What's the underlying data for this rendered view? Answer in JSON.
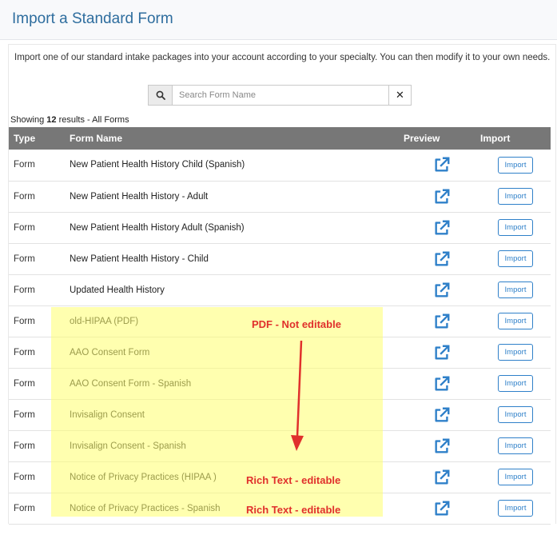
{
  "header": {
    "title": "Import a Standard Form"
  },
  "intro": "Import one of our standard intake packages into your account according to your specialty. You can then modify it to your own needs.",
  "search": {
    "placeholder": "Search Form Name",
    "value": ""
  },
  "results": {
    "prefix": "Showing ",
    "count": "12",
    "suffix": " results - All Forms"
  },
  "table": {
    "headers": {
      "type": "Type",
      "name": "Form Name",
      "preview": "Preview",
      "import": "Import"
    },
    "rows": [
      {
        "type": "Form",
        "name": "New Patient Health History Child (Spanish)",
        "import_label": "Import"
      },
      {
        "type": "Form",
        "name": "New Patient Health History - Adult",
        "import_label": "Import"
      },
      {
        "type": "Form",
        "name": "New Patient Health History Adult (Spanish)",
        "import_label": "Import"
      },
      {
        "type": "Form",
        "name": "New Patient Health History - Child",
        "import_label": "Import"
      },
      {
        "type": "Form",
        "name": "Updated Health History",
        "import_label": "Import"
      },
      {
        "type": "Form",
        "name": "old-HIPAA (PDF)",
        "import_label": "Import"
      },
      {
        "type": "Form",
        "name": "AAO Consent Form",
        "import_label": "Import"
      },
      {
        "type": "Form",
        "name": "AAO Consent Form - Spanish",
        "import_label": "Import"
      },
      {
        "type": "Form",
        "name": "Invisalign Consent",
        "import_label": "Import"
      },
      {
        "type": "Form",
        "name": "Invisalign Consent - Spanish",
        "import_label": "Import"
      },
      {
        "type": "Form",
        "name": "Notice of Privacy Practices (HIPAA )",
        "import_label": "Import"
      },
      {
        "type": "Form",
        "name": "Notice of Privacy Practices - Spanish",
        "import_label": "Import"
      }
    ]
  },
  "annotations": {
    "pdf_note": "PDF - Not editable",
    "rich_text_note_1": "Rich Text - editable",
    "rich_text_note_2": "Rich Text - editable",
    "color": "#e0302c",
    "highlight_color": "#ffff6e"
  },
  "colors": {
    "accent": "#2f80c9",
    "title": "#2e6d9e",
    "table_header": "#777777"
  }
}
